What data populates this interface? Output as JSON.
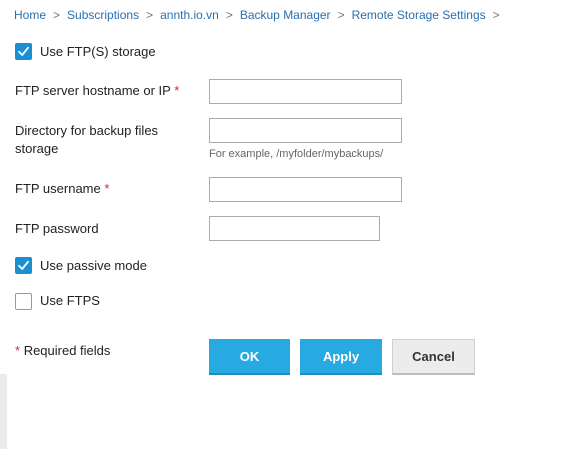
{
  "breadcrumb": {
    "items": [
      "Home",
      "Subscriptions",
      "annth.io.vn",
      "Backup Manager",
      "Remote Storage Settings"
    ],
    "separator": ">"
  },
  "storage": {
    "use_ftp_label": "Use FTP(S) storage",
    "use_ftp_checked": true
  },
  "form": {
    "hostname_label": "FTP server hostname or IP",
    "hostname_value": "",
    "directory_label": "Directory for backup files storage",
    "directory_value": "",
    "directory_hint": "For example, /myfolder/mybackups/",
    "username_label": "FTP username",
    "username_value": "",
    "password_label": "FTP password",
    "password_value": "",
    "required_marker": "*",
    "passive_label": "Use passive mode",
    "passive_checked": true,
    "ftps_label": "Use FTPS",
    "ftps_checked": false
  },
  "footer": {
    "required_note": "Required fields",
    "ok_label": "OK",
    "apply_label": "Apply",
    "cancel_label": "Cancel"
  },
  "colors": {
    "accent": "#27a9e1",
    "link": "#2a6fb0",
    "required": "#c8312f",
    "checkbox": "#1a8fd1"
  }
}
